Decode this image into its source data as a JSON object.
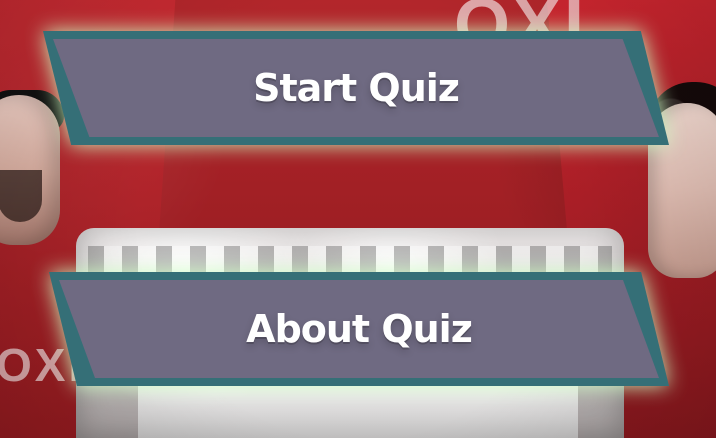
{
  "screen": {
    "buttons": {
      "start_quiz": "Start Quiz",
      "about_quiz": "About Quiz"
    },
    "background": {
      "top_letters": "OXI",
      "bottom_letters": "OXI"
    },
    "colors": {
      "button_fill": "#6f6a82",
      "button_border": "#356f77",
      "button_glow": "#cdffc3",
      "text": "#ffffff",
      "background_red": "#a82227"
    }
  }
}
